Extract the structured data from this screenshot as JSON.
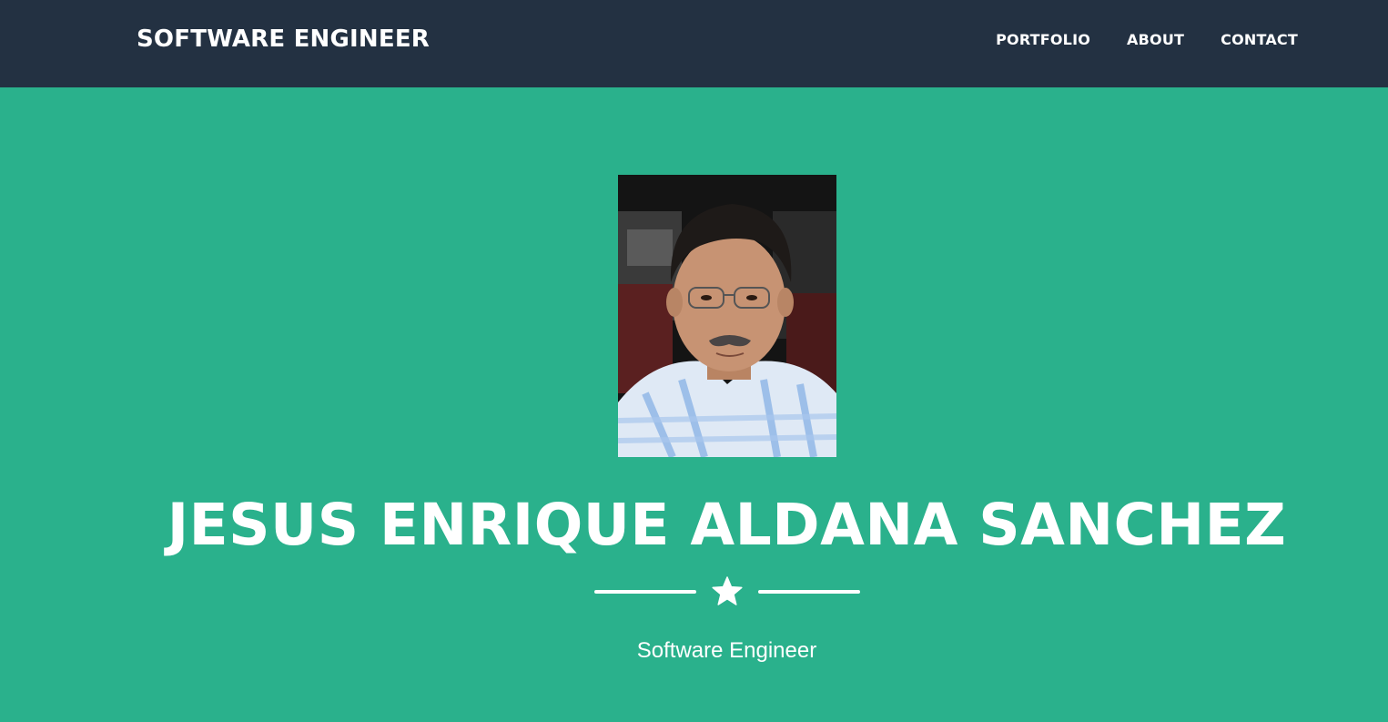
{
  "navbar": {
    "brand": "SOFTWARE ENGINEER",
    "links": [
      "PORTFOLIO",
      "ABOUT",
      "CONTACT"
    ]
  },
  "hero": {
    "name": "JESUS ENRIQUE ALDANA SANCHEZ",
    "subtitle": "Software Engineer",
    "divider_icon": "star-icon"
  },
  "colors": {
    "navbar_bg": "#233142",
    "hero_bg": "#2ab18c",
    "text": "#ffffff"
  }
}
